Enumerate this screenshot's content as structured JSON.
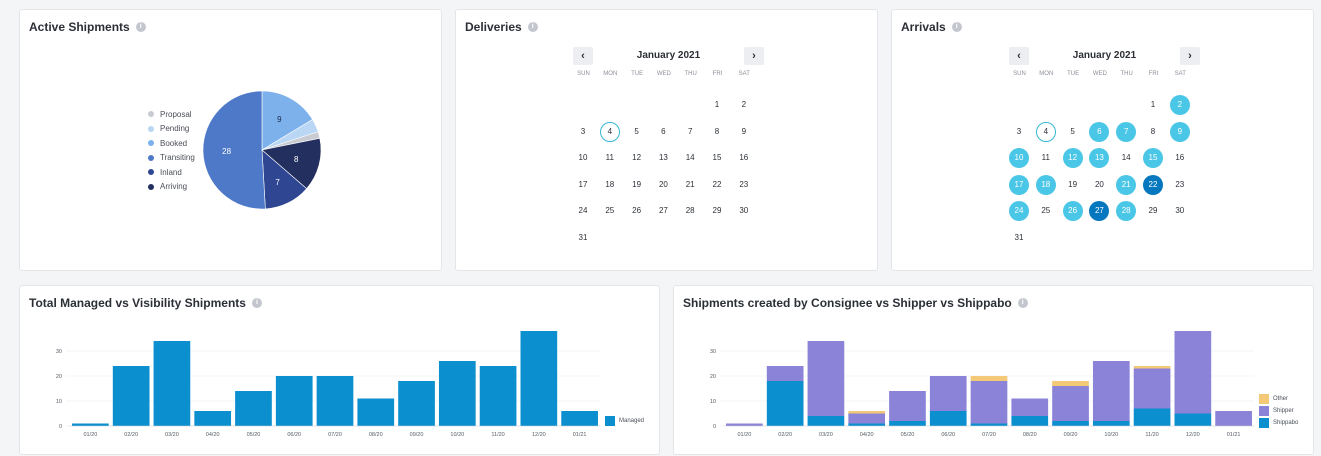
{
  "colors": {
    "proposal": "#c8ccd2",
    "pending": "#b9d6f4",
    "booked": "#7db1ec",
    "transiting": "#4d79c8",
    "inland": "#2f4693",
    "arriving": "#232f5e",
    "managed": "#0c8fcf",
    "other": "#f3c877",
    "shipper": "#8a83d8",
    "shippabo": "#0c8fcf",
    "calendar_highlight": "#4ac6e6",
    "calendar_selected": "#0477be"
  },
  "active_shipments": {
    "title": "Active Shipments",
    "info_icon": "i",
    "legend": [
      "Proposal",
      "Pending",
      "Booked",
      "Transiting",
      "Inland",
      "Arriving"
    ],
    "slice_labels": [
      "9",
      "28",
      "7",
      "8"
    ]
  },
  "deliveries": {
    "title": "Deliveries",
    "info_icon": "i",
    "month": "January 2021",
    "prev": "‹",
    "next": "›",
    "weekdays": [
      "SUN",
      "MON",
      "TUE",
      "WED",
      "THU",
      "FRI",
      "SAT"
    ],
    "days": [
      "1",
      "2",
      "3",
      "4",
      "5",
      "6",
      "7",
      "8",
      "9",
      "10",
      "11",
      "12",
      "13",
      "14",
      "15",
      "16",
      "17",
      "18",
      "19",
      "20",
      "21",
      "22",
      "23",
      "24",
      "25",
      "26",
      "27",
      "28",
      "29",
      "30",
      "31"
    ]
  },
  "arrivals": {
    "title": "Arrivals",
    "info_icon": "i",
    "month": "January 2021",
    "prev": "‹",
    "next": "›",
    "weekdays": [
      "SUN",
      "MON",
      "TUE",
      "WED",
      "THU",
      "FRI",
      "SAT"
    ],
    "days": [
      "1",
      "2",
      "3",
      "4",
      "5",
      "6",
      "7",
      "8",
      "9",
      "10",
      "11",
      "12",
      "13",
      "14",
      "15",
      "16",
      "17",
      "18",
      "19",
      "20",
      "21",
      "22",
      "23",
      "24",
      "25",
      "26",
      "27",
      "28",
      "29",
      "30",
      "31"
    ]
  },
  "managed_chart": {
    "title": "Total Managed vs Visibility Shipments",
    "info_icon": "i",
    "legend": "Managed",
    "y_ticks": [
      "0",
      "10",
      "20",
      "30"
    ]
  },
  "consignee_chart": {
    "title": "Shipments created by Consignee vs Shipper vs Shippabo",
    "info_icon": "i",
    "legend": [
      "Other",
      "Shipper",
      "Shippabo"
    ],
    "y_ticks": [
      "0",
      "10",
      "20",
      "30"
    ]
  },
  "chart_data": [
    {
      "type": "pie",
      "title": "Active Shipments",
      "categories": [
        "Proposal",
        "Pending",
        "Booked",
        "Transiting",
        "Inland",
        "Arriving"
      ],
      "values": [
        1,
        2,
        9,
        28,
        7,
        8
      ]
    },
    {
      "type": "bar",
      "title": "Total Managed vs Visibility Shipments",
      "categories": [
        "01/20",
        "02/20",
        "03/20",
        "04/20",
        "05/20",
        "06/20",
        "07/20",
        "08/20",
        "09/20",
        "10/20",
        "11/20",
        "12/20",
        "01/21"
      ],
      "series": [
        {
          "name": "Managed",
          "values": [
            1,
            24,
            34,
            6,
            14,
            20,
            20,
            11,
            18,
            26,
            24,
            38,
            6
          ]
        }
      ],
      "ylim": [
        0,
        40
      ],
      "y_ticks": [
        0,
        10,
        20,
        30
      ],
      "grid": true,
      "legend": "right"
    },
    {
      "type": "bar",
      "title": "Shipments created by Consignee vs Shipper vs Shippabo",
      "stacked": true,
      "categories": [
        "01/20",
        "02/20",
        "03/20",
        "04/20",
        "05/20",
        "06/20",
        "07/20",
        "08/20",
        "09/20",
        "10/20",
        "11/20",
        "12/20",
        "01/21"
      ],
      "series": [
        {
          "name": "Shippabo",
          "values": [
            0,
            18,
            4,
            1,
            2,
            6,
            1,
            4,
            2,
            2,
            7,
            5,
            0
          ]
        },
        {
          "name": "Shipper",
          "values": [
            1,
            6,
            30,
            4,
            12,
            14,
            17,
            7,
            14,
            24,
            16,
            33,
            6
          ]
        },
        {
          "name": "Other",
          "values": [
            0,
            0,
            0,
            1,
            0,
            0,
            2,
            0,
            2,
            0,
            1,
            0,
            0
          ]
        }
      ],
      "ylim": [
        0,
        40
      ],
      "y_ticks": [
        0,
        10,
        20,
        30
      ],
      "grid": true,
      "legend": "right"
    }
  ]
}
